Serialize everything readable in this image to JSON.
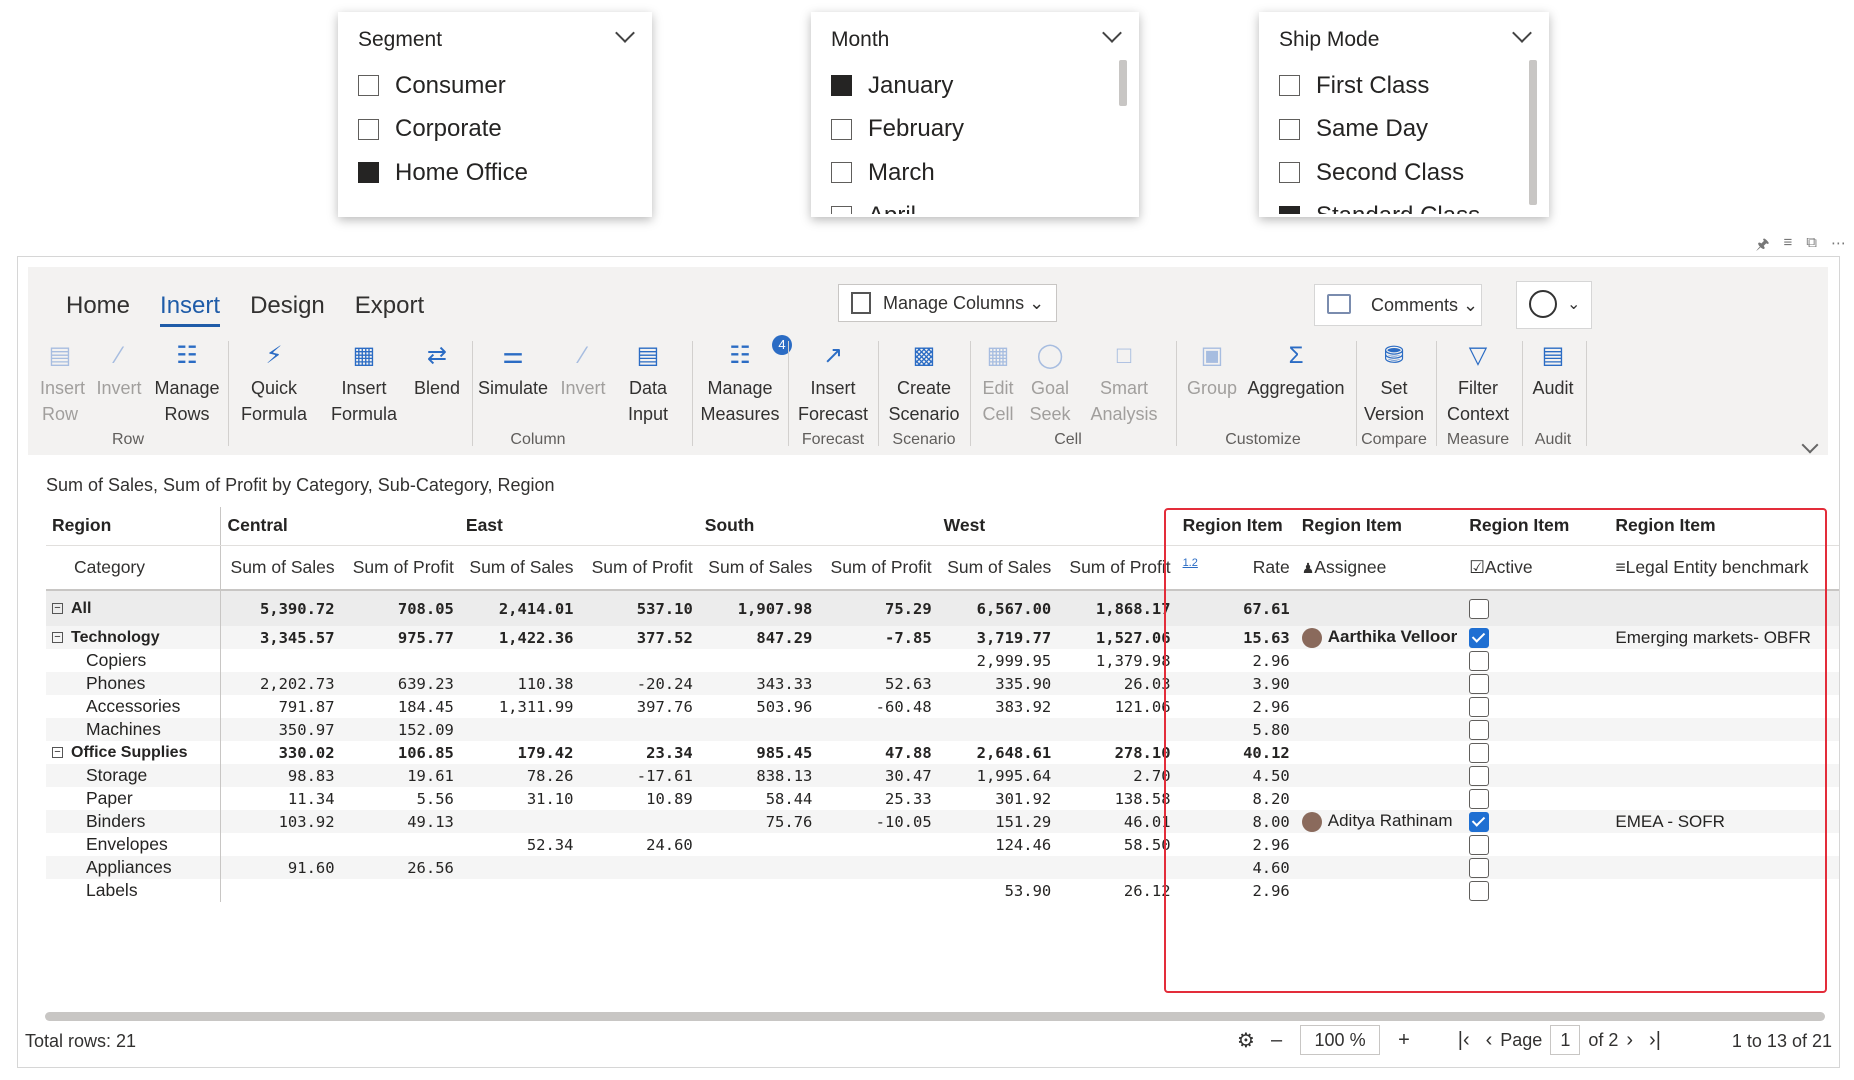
{
  "slicers": {
    "segment": {
      "title": "Segment",
      "options": [
        {
          "label": "Consumer",
          "checked": false
        },
        {
          "label": "Corporate",
          "checked": false
        },
        {
          "label": "Home Office",
          "checked": true
        }
      ]
    },
    "month": {
      "title": "Month",
      "options": [
        {
          "label": "January",
          "checked": true
        },
        {
          "label": "February",
          "checked": false
        },
        {
          "label": "March",
          "checked": false
        },
        {
          "label": "April",
          "checked": false
        }
      ]
    },
    "ship_mode": {
      "title": "Ship Mode",
      "options": [
        {
          "label": "First Class",
          "checked": false
        },
        {
          "label": "Same Day",
          "checked": false
        },
        {
          "label": "Second Class",
          "checked": false
        },
        {
          "label": "Standard Class",
          "checked": true
        }
      ]
    }
  },
  "tabs": [
    "Home",
    "Insert",
    "Design",
    "Export"
  ],
  "active_tab": "Insert",
  "manage_columns": "Manage Columns",
  "comments": "Comments",
  "ribbon": {
    "insert_row": "Insert Row",
    "invert_row": "Invert",
    "manage_rows": "Manage Rows",
    "quick_formula": "Quick Formula",
    "insert_formula": "Insert Formula",
    "blend": "Blend",
    "simulate": "Simulate",
    "invert_col": "Invert",
    "data_input": "Data Input",
    "manage_measures": "Manage Measures",
    "measures_badge": "4",
    "insert_forecast": "Insert Forecast",
    "create_scenario": "Create Scenario",
    "edit_cell": "Edit Cell",
    "goal_seek": "Goal Seek",
    "smart_analysis": "Smart Analysis",
    "group": "Group",
    "aggregation": "Aggregation",
    "set_version": "Set Version",
    "filter_context": "Filter Context",
    "audit": "Audit",
    "groups": {
      "row": "Row",
      "column": "Column",
      "forecast": "Forecast",
      "scenario": "Scenario",
      "cell": "Cell",
      "customize": "Customize",
      "compare": "Compare",
      "measure": "Measure",
      "audit": "Audit"
    }
  },
  "caption": "Sum of Sales, Sum of Profit by Category, Sub-Category, Region",
  "table": {
    "region_header": "Region",
    "category_header": "Category",
    "regions": [
      "Central",
      "East",
      "South",
      "West"
    ],
    "measures": [
      "Sum of Sales",
      "Sum of Profit"
    ],
    "extra_group": "Region Item",
    "extra_cols": [
      "Rate",
      "Assignee",
      "Active",
      "Legal Entity benchmark"
    ],
    "rate_icon": "1.2",
    "rows": [
      {
        "label": "All",
        "type": "total",
        "vals": [
          "5,390.72",
          "708.05",
          "2,414.01",
          "537.10",
          "1,907.98",
          "75.29",
          "6,567.00",
          "1,868.17"
        ],
        "rate": "67.61",
        "assignee": "",
        "active": false,
        "bench": ""
      },
      {
        "label": "Technology",
        "type": "group",
        "vals": [
          "3,345.57",
          "975.77",
          "1,422.36",
          "377.52",
          "847.29",
          "-7.85",
          "3,719.77",
          "1,527.06"
        ],
        "rate": "15.63",
        "assignee": "Aarthika Velloor",
        "active": true,
        "bench": "Emerging markets- OBFR"
      },
      {
        "label": "Copiers",
        "type": "item",
        "vals": [
          "",
          "",
          "",
          "",
          "",
          "",
          "2,999.95",
          "1,379.98"
        ],
        "rate": "2.96",
        "assignee": "",
        "active": false,
        "bench": ""
      },
      {
        "label": "Phones",
        "type": "item",
        "vals": [
          "2,202.73",
          "639.23",
          "110.38",
          "-20.24",
          "343.33",
          "52.63",
          "335.90",
          "26.03"
        ],
        "rate": "3.90",
        "assignee": "",
        "active": false,
        "bench": ""
      },
      {
        "label": "Accessories",
        "type": "item",
        "vals": [
          "791.87",
          "184.45",
          "1,311.99",
          "397.76",
          "503.96",
          "-60.48",
          "383.92",
          "121.06"
        ],
        "rate": "2.96",
        "assignee": "",
        "active": false,
        "bench": ""
      },
      {
        "label": "Machines",
        "type": "item",
        "vals": [
          "350.97",
          "152.09",
          "",
          "",
          "",
          "",
          "",
          ""
        ],
        "rate": "5.80",
        "assignee": "",
        "active": false,
        "bench": ""
      },
      {
        "label": "Office Supplies",
        "type": "group",
        "vals": [
          "330.02",
          "106.85",
          "179.42",
          "23.34",
          "985.45",
          "47.88",
          "2,648.61",
          "278.10"
        ],
        "rate": "40.12",
        "assignee": "",
        "active": false,
        "bench": ""
      },
      {
        "label": "Storage",
        "type": "item",
        "vals": [
          "98.83",
          "19.61",
          "78.26",
          "-17.61",
          "838.13",
          "30.47",
          "1,995.64",
          "2.70"
        ],
        "rate": "4.50",
        "assignee": "",
        "active": false,
        "bench": ""
      },
      {
        "label": "Paper",
        "type": "item",
        "vals": [
          "11.34",
          "5.56",
          "31.10",
          "10.89",
          "58.44",
          "25.33",
          "301.92",
          "138.58"
        ],
        "rate": "8.20",
        "assignee": "",
        "active": false,
        "bench": ""
      },
      {
        "label": "Binders",
        "type": "item",
        "vals": [
          "103.92",
          "49.13",
          "",
          "",
          "75.76",
          "-10.05",
          "151.29",
          "46.01"
        ],
        "rate": "8.00",
        "assignee": "Aditya Rathinam",
        "active": true,
        "bench": "EMEA - SOFR"
      },
      {
        "label": "Envelopes",
        "type": "item",
        "vals": [
          "",
          "",
          "52.34",
          "24.60",
          "",
          "",
          "124.46",
          "58.50"
        ],
        "rate": "2.96",
        "assignee": "",
        "active": false,
        "bench": ""
      },
      {
        "label": "Appliances",
        "type": "item",
        "vals": [
          "91.60",
          "26.56",
          "",
          "",
          "",
          "",
          "",
          ""
        ],
        "rate": "4.60",
        "assignee": "",
        "active": false,
        "bench": ""
      },
      {
        "label": "Labels",
        "type": "item",
        "vals": [
          "",
          "",
          "",
          "",
          "",
          "",
          "53.90",
          "26.12"
        ],
        "rate": "2.96",
        "assignee": "",
        "active": false,
        "bench": ""
      }
    ]
  },
  "footer": {
    "total_rows": "Total rows: 21",
    "zoom": "100 %",
    "page_label": "Page",
    "page": "1",
    "of_pages": "of 2",
    "range": "1 to 13 of 21"
  },
  "colors": {
    "accent": "#1f5ca8",
    "highlight_border": "#e32d3a",
    "checkbox_on": "#1f6fd2"
  }
}
